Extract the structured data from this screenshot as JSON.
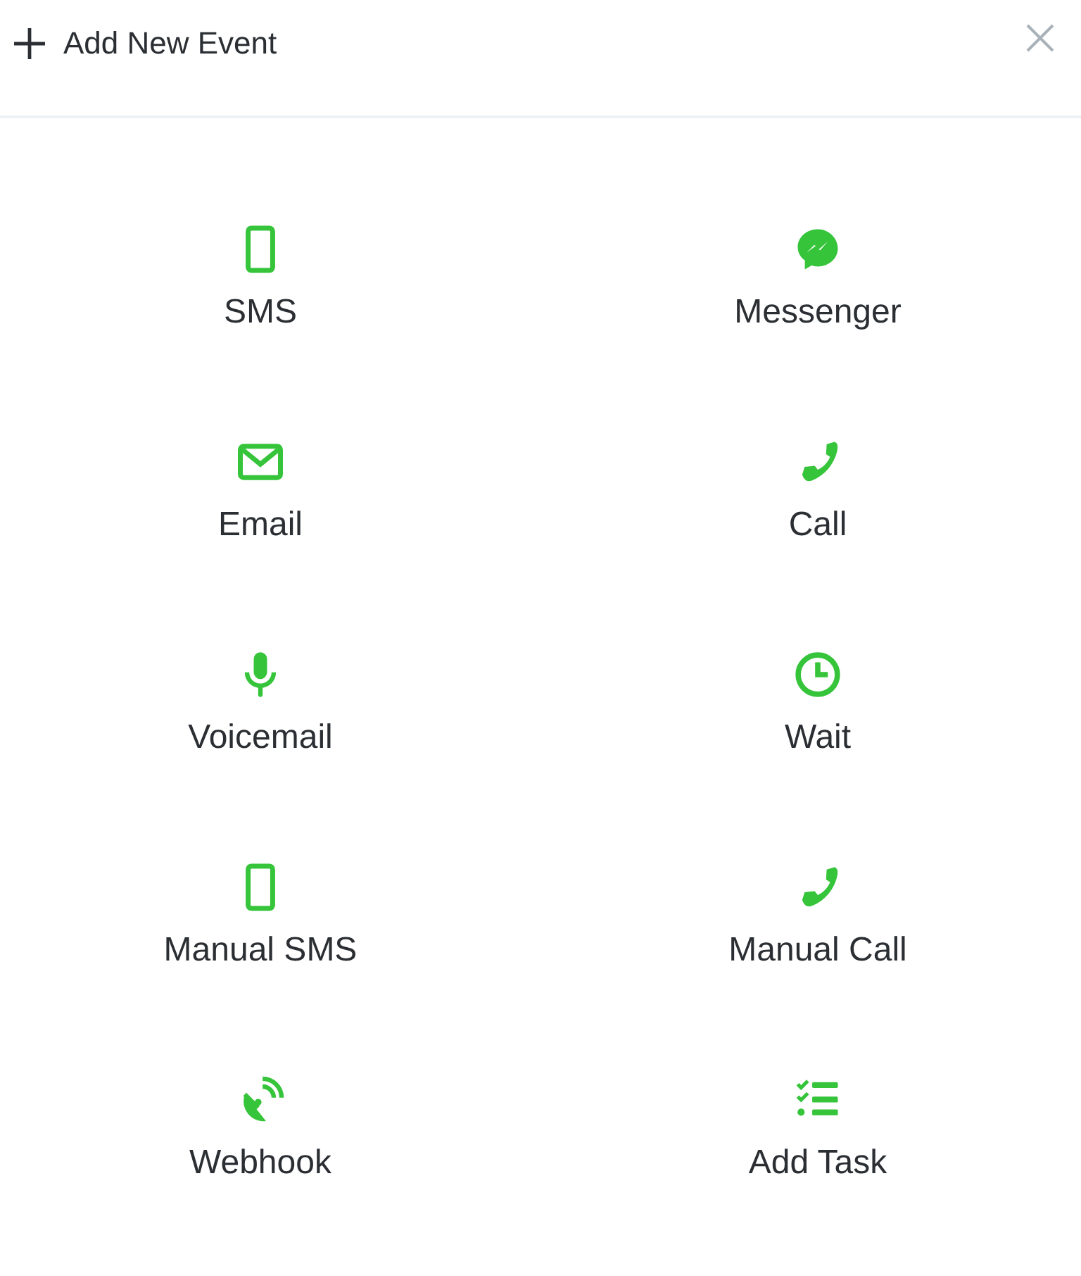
{
  "header": {
    "title": "Add New Event"
  },
  "events": [
    {
      "label": "SMS",
      "kind": "mobile"
    },
    {
      "label": "Messenger",
      "kind": "messenger"
    },
    {
      "label": "Email",
      "kind": "email"
    },
    {
      "label": "Call",
      "kind": "phone"
    },
    {
      "label": "Voicemail",
      "kind": "mic"
    },
    {
      "label": "Wait",
      "kind": "clock"
    },
    {
      "label": "Manual SMS",
      "kind": "mobile"
    },
    {
      "label": "Manual Call",
      "kind": "phone"
    },
    {
      "label": "Webhook",
      "kind": "dish"
    },
    {
      "label": "Add Task",
      "kind": "tasks"
    }
  ]
}
